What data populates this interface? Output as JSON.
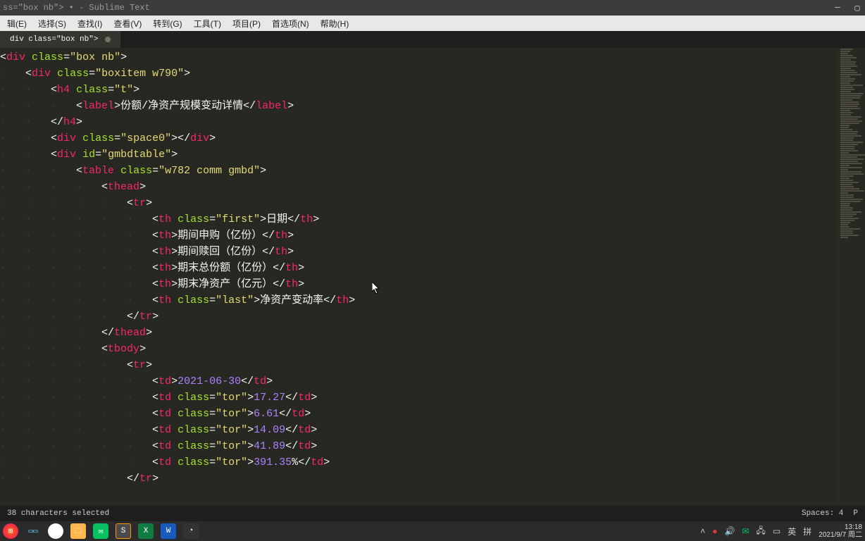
{
  "title_bar": {
    "text": "ss=\"box nb\"> • - Sublime Text"
  },
  "menu": {
    "items": [
      "辑(E)",
      "选择(S)",
      "查找(I)",
      "查看(V)",
      "转到(G)",
      "工具(T)",
      "项目(P)",
      "首选项(N)",
      "帮助(H)"
    ]
  },
  "tab": {
    "label": "div class=\"box nb\">"
  },
  "code": {
    "lines": [
      {
        "indent": 0,
        "tag_open": "div",
        "attr": "class",
        "val": "box nb"
      },
      {
        "indent": 1,
        "tag_open": "div",
        "attr": "class",
        "val": "boxitem w790"
      },
      {
        "indent": 2,
        "tag_open": "h4",
        "attr": "class",
        "val": "t"
      },
      {
        "indent": 3,
        "wrap": "label",
        "text": "份额/净资产规模变动详情"
      },
      {
        "indent": 2,
        "tag_close": "h4"
      },
      {
        "indent": 2,
        "self": "div",
        "attr": "class",
        "val": "space0"
      },
      {
        "indent": 2,
        "tag_open": "div",
        "attr": "id",
        "val": "gmbdtable"
      },
      {
        "indent": 3,
        "tag_open": "table",
        "attr": "class",
        "val": "w782 comm gmbd"
      },
      {
        "indent": 4,
        "tag_open": "thead"
      },
      {
        "indent": 5,
        "tag_open": "tr"
      },
      {
        "indent": 6,
        "wrap": "th",
        "attr": "class",
        "val": "first",
        "text": "日期"
      },
      {
        "indent": 6,
        "wrap": "th",
        "text": "期间申购（亿份）"
      },
      {
        "indent": 6,
        "wrap": "th",
        "text": "期间赎回（亿份）"
      },
      {
        "indent": 6,
        "wrap": "th",
        "text": "期末总份额（亿份）"
      },
      {
        "indent": 6,
        "wrap": "th",
        "text": "期末净资产（亿元）"
      },
      {
        "indent": 6,
        "wrap": "th",
        "attr": "class",
        "val": "last",
        "text": "净资产变动率"
      },
      {
        "indent": 5,
        "tag_close": "tr"
      },
      {
        "indent": 4,
        "tag_close": "thead"
      },
      {
        "indent": 4,
        "tag_open": "tbody"
      },
      {
        "indent": 5,
        "tag_open": "tr"
      },
      {
        "indent": 6,
        "wrap": "td",
        "num": "2021-06-30"
      },
      {
        "indent": 6,
        "wrap": "td",
        "attr": "class",
        "val": "tor",
        "num": "17.27"
      },
      {
        "indent": 6,
        "wrap": "td",
        "attr": "class",
        "val": "tor",
        "num": "6.61"
      },
      {
        "indent": 6,
        "wrap": "td",
        "attr": "class",
        "val": "tor",
        "num": "14.09"
      },
      {
        "indent": 6,
        "wrap": "td",
        "attr": "class",
        "val": "tor",
        "num": "41.89"
      },
      {
        "indent": 6,
        "wrap": "td",
        "attr": "class",
        "val": "tor",
        "num": "391.35",
        "suffix": "%"
      },
      {
        "indent": 5,
        "tag_close": "tr"
      }
    ]
  },
  "status": {
    "left": "38 characters selected",
    "spaces": "Spaces: 4",
    "lang": "P"
  },
  "taskbar": {
    "time": "13:18",
    "date": "2021/9/7 周二",
    "ime": "英",
    "symbol": "拼"
  }
}
